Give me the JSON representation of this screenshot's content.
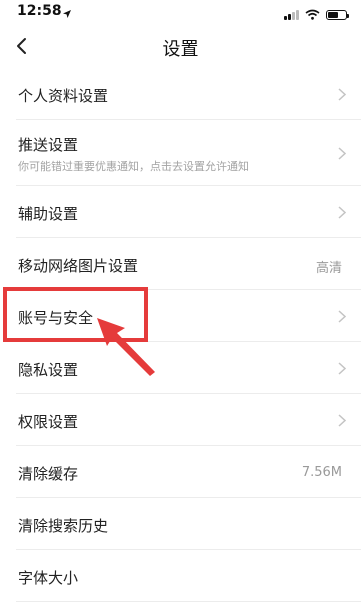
{
  "status_bar": {
    "time": "12:58"
  },
  "header": {
    "title": "设置"
  },
  "settings": [
    {
      "label": "个人资料设置",
      "value": "",
      "sub": "",
      "chevron": true
    },
    {
      "label": "推送设置",
      "value": "",
      "sub": "你可能错过重要优惠通知，点击去设置允许通知",
      "chevron": true
    },
    {
      "label": "辅助设置",
      "value": "",
      "sub": "",
      "chevron": true
    },
    {
      "label": "移动网络图片设置",
      "value": "高清",
      "sub": "",
      "chevron": false
    },
    {
      "label": "账号与安全",
      "value": "",
      "sub": "",
      "chevron": true
    },
    {
      "label": "隐私设置",
      "value": "",
      "sub": "",
      "chevron": true
    },
    {
      "label": "权限设置",
      "value": "",
      "sub": "",
      "chevron": true
    },
    {
      "label": "清除缓存",
      "value": "7.56M",
      "sub": "",
      "chevron": false
    },
    {
      "label": "清除搜索历史",
      "value": "",
      "sub": "",
      "chevron": false
    },
    {
      "label": "字体大小",
      "value": "",
      "sub": "",
      "chevron": false
    }
  ],
  "colors": {
    "annotation_red": "#e53b3b",
    "separator": "#ececec",
    "secondary_text": "#9a9a9a"
  },
  "icons": [
    "location-arrow-icon",
    "signal-icon",
    "wifi-icon",
    "battery-icon",
    "back-arrow-icon",
    "chevron-right-icon"
  ]
}
